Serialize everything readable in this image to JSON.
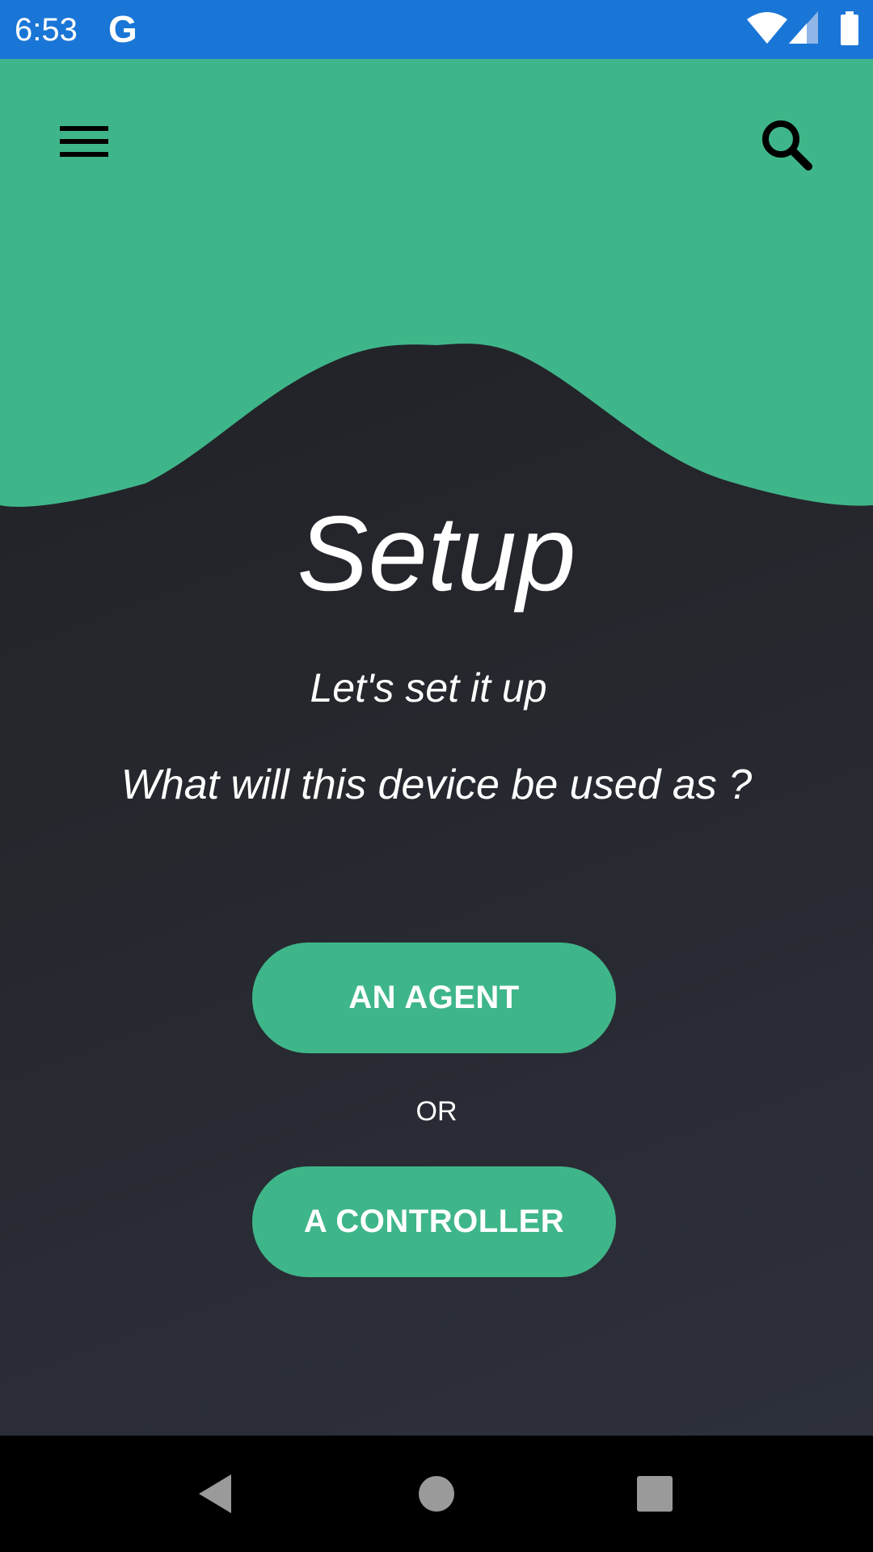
{
  "status_bar": {
    "time": "6:53",
    "google_glyph": "G",
    "icons": [
      "wifi-icon",
      "signal-icon",
      "battery-icon"
    ]
  },
  "header": {
    "menu_icon": "menu-icon",
    "search_icon": "search-icon"
  },
  "main": {
    "title": "Setup",
    "subtitle": "Let's set it up",
    "question": "What will this device be used as ?",
    "agent_button": "AN AGENT",
    "or_label": "OR",
    "controller_button": "A CONTROLLER"
  },
  "nav_bar": {
    "icons": [
      "back-icon",
      "home-icon",
      "recents-icon"
    ]
  },
  "colors": {
    "status_bar": "#1a76d6",
    "accent_green": "#3fb689",
    "background_dark": "#23252b",
    "text": "#ffffff"
  }
}
